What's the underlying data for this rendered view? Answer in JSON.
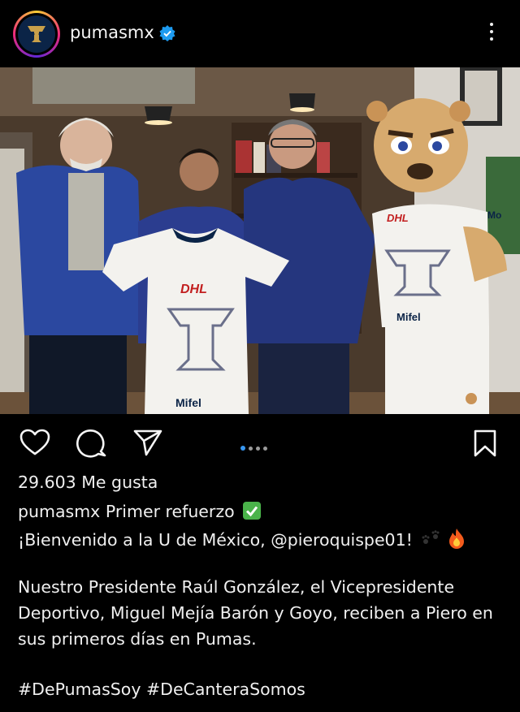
{
  "header": {
    "username": "pumasmx",
    "verified_icon": "verified-badge-icon",
    "more_icon": "more-options-icon"
  },
  "photo": {
    "jersey_sponsor": "DHL",
    "jersey_brand": "Mifel",
    "mascot_shirt_sponsor": "DHL",
    "mascot_shirt_brand": "Mifel",
    "mascot_sleeve_text": "Mo"
  },
  "actions": {
    "like_icon": "heart-icon",
    "comment_icon": "comment-icon",
    "share_icon": "send-icon",
    "save_icon": "bookmark-icon",
    "carousel_total": 4,
    "carousel_active": 1
  },
  "post": {
    "likes": "29.603 Me gusta",
    "caption_user": "pumasmx",
    "caption_line1": "Primer refuerzo",
    "caption_line2": "¡Bienvenido a la U de México, @pieroquispe01!",
    "body_line1": "Nuestro Presidente Raúl González, el Vicepresidente",
    "body_line2": "Deportivo, Miguel Mejía Barón y Goyo, reciben a Piero en",
    "body_line3": "sus primeros días en Pumas.",
    "hashtags": "#DePumasSoy #DeCanteraSomos"
  },
  "colors": {
    "background": "#000000",
    "text": "#f0f0f0",
    "accent_blue": "#3897f0",
    "verified_blue": "#1d9bf0",
    "club_navy": "#0b2447",
    "club_gold": "#c9a04a"
  }
}
